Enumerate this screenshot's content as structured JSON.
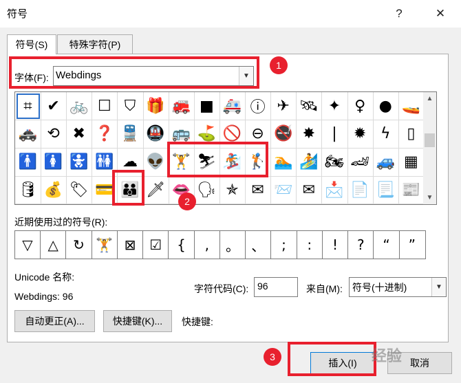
{
  "window": {
    "title": "符号",
    "help_glyph": "?",
    "close_glyph": "✕"
  },
  "tabs": [
    {
      "label": "符号(S)"
    },
    {
      "label": "特殊字符(P)"
    }
  ],
  "font": {
    "label": "字体(F):",
    "value": "Webdings"
  },
  "symbol_rows": [
    [
      "⌗",
      "✔",
      "🚲",
      "☐",
      "⛉",
      "🎁",
      "🚒",
      "■",
      "🚑",
      "ⓘ",
      "✈",
      "🛰",
      "✦",
      "♀",
      "●",
      "🚤"
    ],
    [
      "🚓",
      "⟲",
      "✖",
      "❓",
      "🚆",
      "🚇",
      "🚌",
      "⛳",
      "🚫",
      "⊖",
      "🚭",
      "✸",
      "|",
      "✹",
      "ϟ",
      "▯"
    ],
    [
      "🚹",
      "🚺",
      "🚼",
      "🚻",
      "☁",
      "👽",
      "🏋",
      "⛷",
      "🏂",
      "🏌",
      "🏊",
      "🏄",
      "🏍",
      "🏎",
      "🚙",
      "▦"
    ],
    [
      "🛢",
      "💰",
      "🏷",
      "💳",
      "👪",
      "🗡",
      "👄",
      "🗣",
      "✯",
      "✉",
      "📨",
      "✉",
      "📩",
      "📄",
      "📃",
      "📰"
    ]
  ],
  "recent": {
    "label": "近期使用过的符号(R):",
    "symbols": [
      "▽",
      "△",
      "↻",
      "🏋",
      "⊠",
      "☑",
      "{",
      ",",
      "。",
      "、",
      ";",
      ":",
      "!",
      "?",
      "“",
      "”"
    ]
  },
  "unicode": {
    "label": "Unicode 名称:",
    "value": "Webdings: 96"
  },
  "charcode": {
    "label": "字符代码(C):",
    "value": "96"
  },
  "from": {
    "label": "来自(M):",
    "value": "符号(十进制)"
  },
  "buttons": {
    "autocorrect": "自动更正(A)...",
    "shortcut": "快捷键(K)...",
    "shortcut_label": "快捷键:",
    "insert": "插入(I)",
    "cancel": "取消"
  },
  "annotations": [
    "1",
    "2",
    "3"
  ],
  "watermark": "经验",
  "colors": {
    "accent_red": "#e8202e",
    "selection_blue": "#2b6fc8"
  }
}
